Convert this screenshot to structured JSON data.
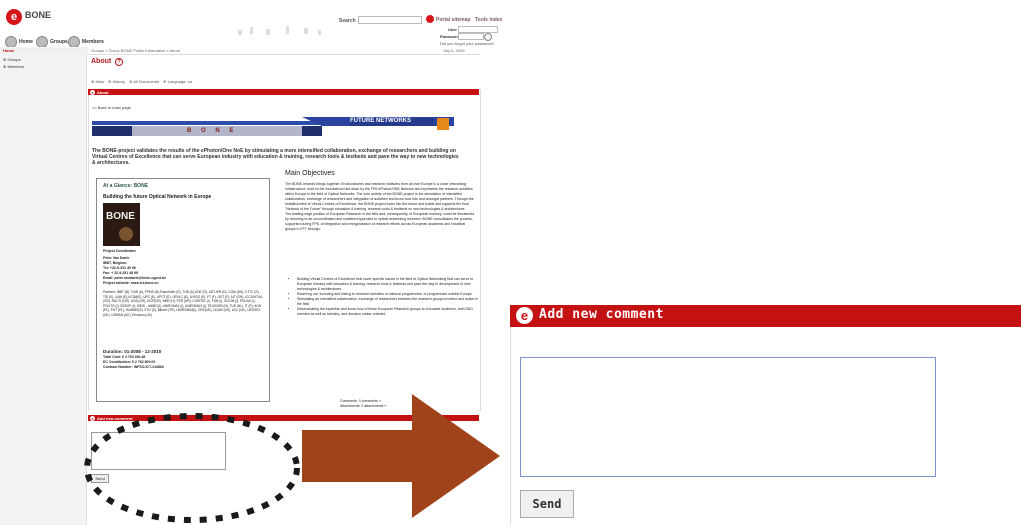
{
  "header": {
    "logo_letter": "e",
    "logo_text": "BONE",
    "search_label": "Search",
    "portal_link": "Portal sitemap",
    "tools_link": "Tools index",
    "user_label": "User",
    "password_label": "Password",
    "forgot_link": "Did you forget your password?",
    "nav": [
      {
        "label": "Home",
        "icon": "home-icon"
      },
      {
        "label": "Groups",
        "icon": "groups-icon"
      },
      {
        "label": "Members",
        "icon": "members-icon"
      }
    ]
  },
  "sidebar": {
    "head": "Home",
    "items": [
      "Groups",
      "Members"
    ]
  },
  "breadcrumb": "Groups » Group BONE Public Information » About",
  "date": "July 6, 2009",
  "page_title": "About",
  "tabs": [
    "Main",
    "History",
    "All Documents",
    "Language: ca"
  ],
  "about_bar": "About",
  "back_link": ">> Back to main page",
  "banner": {
    "left": "B O N E",
    "right": "FUTURE NETWORKS"
  },
  "intro": "The BONE-project validates the results of the ePhoton/One NoE by stimulating a more intensified collaboration, exchange of researchers and building on Virtual Centres of Excellence that can serve European industry with education & training, research tools & testbeds and pave the way to new technologies & architectures.",
  "glance": {
    "title": "At a Glance: BONE",
    "subtitle": "Building the future Optical Network in Europe",
    "logo_text": "BONE",
    "coordinator_label": "Project Coordinator",
    "coordinator": [
      "Peter Van Daele",
      "IBBT, Belgium",
      "Tel: +32-9-331 49 06",
      "Fax: + 32-9-331 48 99",
      "Email: peter.vandaele@intec.ugent.be",
      "Project website: www.ict-bone.eu"
    ],
    "partners": "Partners: IBBT (B), TUW (A), FPMS (B),Fraunhofer (D), TUB (D),UDE (D), UST-IKR (D), COM (DK), CTTC (E), TID (E), UAM (E),UC3M(E), UPC (E), UPCT (E), UPVLC (E), UVIGO (E), FT (F), GET (F), AIT (GR), ICCS/NTUA (GR), RACTI (GR), UOA (GR), UOP(GR), BME (H), FER (HR), CORITEL (I), FUB (I), ISCOM (I), POLIMI (I), POLITO (I), SSSUP (I), SIEIS - UNIBO(I), UNIROMA1 (I), UNIROMA3 (I), TELENOR (N), TUE (NL), IT (P), AGH (PL), PUT (PL), HUAWEI(S), KTH (S), Bilkent (TR), UNIROMA3(I), ORC(UK), UCAM (UK), UCL (UK), UESSEX (UK), USWAN (UK), Ericsson (UK)",
    "duration": "Duration: 01-2008 - 12-2010",
    "total_cost": "Total Cost: € 4 793 000.46",
    "ec_contribution": "EC Contribution: € 2 762 800.00",
    "contract": "Contract Number: INFSO-ICT-216863"
  },
  "main_objectives": {
    "title": "Main Objectives",
    "para1": "The BONE-network brings together 49 laboratories and research institutes from all over Europe in a close networking infrastructure, built on the foundations laid down by the FP6 ePhoton/ONE Network and represents the research activities within Europe in the field of Optical Networks. The core activity of the BONE-project is the stimulation of intensified collaboration, exchange of researchers and integration of activities and know-how into and amongst partners. Through the establishment of Virtual Centres of Excellence, the BONE-project looks into the future and builds and supports the final \"Network of the Future\" through education & training, research tools & testbeds on new technologies & architectures.",
    "para2": "The leading-edge position of European Research in the field and, consequently, of European industry, could be threatened by returning to an uncoordinated and scattered approach to optical networking research. BONE consolidates the process, supported during FP6, of integration and reorganization of research efforts across European academic and industrial groups in FP7 through:",
    "bullets": [
      "Building Virtual Centres of Excellence that cover specific issues in the field of Optical Networking that can serve to European industry with education & training, research tools & testbeds and pave the way to development of new technologies & architectures.",
      "Reaching out, including and linking to research activities in national programmes, or programmes outside Europe.",
      "Stimulating an intensified collaboration, exchange of researchers between the research groups involved and active in the field",
      "Disseminating the expertise and know-how of these European Research groups to a broader audience, both R&D oriented as well as industry- and decision maker oriented."
    ]
  },
  "comments_count": "Comments: 0 comments »",
  "attachments_count": "Attachments: 2 attachments »",
  "add_comment": {
    "title": "Add new comment",
    "send_label": "Send"
  },
  "colors": {
    "brand_red": "#c41212",
    "textarea_border": "#7d93c8",
    "arrow": "#a0431a"
  }
}
